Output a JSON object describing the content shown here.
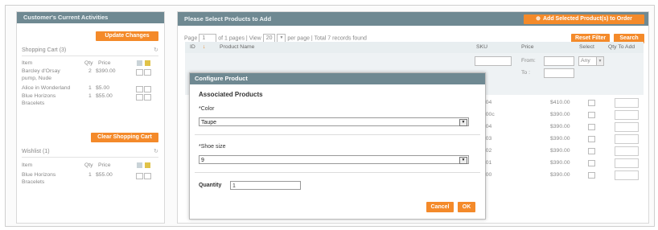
{
  "left_panel": {
    "title": "Customer's Current Activities",
    "update_button": "Update Changes",
    "shopping_cart": {
      "title": "Shopping Cart (3)",
      "headers": {
        "item": "Item",
        "qty": "Qty",
        "price": "Price"
      },
      "rows": [
        {
          "item": "Barcley d'Orsay",
          "qty": "2",
          "price": "$390.00"
        },
        {
          "item": "pump, Nude",
          "qty": "",
          "price": ""
        },
        {
          "item": "Alice in Wonderland",
          "qty": "1",
          "price": "$5.00"
        },
        {
          "item": "Blue Horizons",
          "qty": "1",
          "price": "$55.00"
        },
        {
          "item": "Bracelets",
          "qty": "",
          "price": ""
        }
      ],
      "clear_button": "Clear Shopping Cart"
    },
    "wishlist": {
      "title": "Wishlist (1)",
      "headers": {
        "item": "Item",
        "qty": "Qty",
        "price": "Price"
      },
      "rows": [
        {
          "item": "Blue Horizons",
          "qty": "1",
          "price": "$55.00"
        },
        {
          "item": "Bracelets",
          "qty": "",
          "price": ""
        }
      ]
    }
  },
  "right_panel": {
    "title": "Please Select Products to Add",
    "add_button": "Add Selected Product(s) to Order",
    "pager": {
      "page_label": "Page",
      "page": "1",
      "of_pages": "of 1 pages",
      "view_label": "View",
      "view": "20",
      "per_page": "per page",
      "total": "Total 7 records found"
    },
    "reset_button": "Reset Filter",
    "search_button": "Search",
    "columns": {
      "id": "ID",
      "name": "Product Name",
      "sku": "SKU",
      "price": "Price",
      "select": "Select",
      "qty": "Qty To Add"
    },
    "filter": {
      "from": "From:",
      "to": "To :",
      "select_value": "Any"
    },
    "rows": [
      {
        "sku": "004",
        "price": "$410.00"
      },
      {
        "sku": "000c",
        "price": "$390.00"
      },
      {
        "sku": "004",
        "price": "$390.00"
      },
      {
        "sku": "003",
        "price": "$390.00"
      },
      {
        "sku": "002",
        "price": "$390.00"
      },
      {
        "sku": "001",
        "price": "$390.00"
      },
      {
        "sku": "000",
        "price": "$390.00"
      }
    ]
  },
  "modal": {
    "title": "Configure Product",
    "section_title": "Associated Products",
    "color_label": "*Color",
    "color_value": "Taupe",
    "shoe_label": "*Shoe size",
    "shoe_value": "9",
    "quantity_label": "Quantity",
    "quantity_value": "1",
    "cancel_button": "Cancel",
    "ok_button": "OK"
  },
  "colors": {
    "header": "#6f8992",
    "accent": "#f48a2a"
  }
}
